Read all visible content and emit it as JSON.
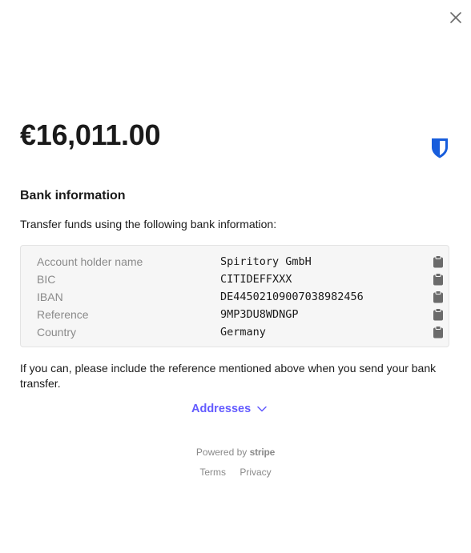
{
  "header": {
    "close_icon": "close-icon"
  },
  "payment": {
    "amount": "€16,011.00",
    "brand_icon": "bitwarden-shield-icon",
    "brand_color": "#175ddc"
  },
  "bank": {
    "title": "Bank information",
    "instructions": "Transfer funds using the following bank information:",
    "rows": [
      {
        "label": "Account holder name",
        "value": "Spiritory GmbH"
      },
      {
        "label": "BIC",
        "value": "CITIDEFFXXX"
      },
      {
        "label": "IBAN",
        "value": "DE44502109007038982456"
      },
      {
        "label": "Reference",
        "value": "9MP3DU8WDNGP"
      },
      {
        "label": "Country",
        "value": "Germany"
      }
    ],
    "copy_icon": "clipboard-icon",
    "note": "If you can, please include the reference mentioned above when you send your bank transfer."
  },
  "addresses": {
    "label": "Addresses",
    "icon": "chevron-down-icon",
    "accent": "#635bff"
  },
  "footer": {
    "powered_by": "Powered by",
    "brand": "stripe",
    "terms": "Terms",
    "privacy": "Privacy"
  }
}
